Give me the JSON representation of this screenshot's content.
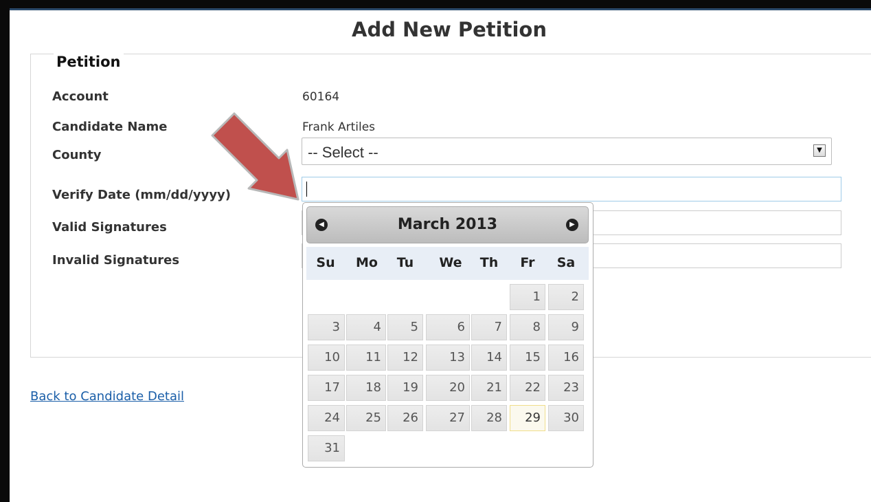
{
  "page": {
    "title": "Add New Petition",
    "section_legend": "Petition",
    "back_link": "Back to Candidate Detail"
  },
  "form": {
    "account": {
      "label": "Account",
      "value": "60164"
    },
    "candidate_name": {
      "label": "Candidate Name",
      "value": "Frank Artiles"
    },
    "county": {
      "label": "County",
      "selected": "-- Select --"
    },
    "verify_date": {
      "label": "Verify Date (mm/dd/yyyy)",
      "value": ""
    },
    "valid_signatures": {
      "label": "Valid Signatures",
      "value": ""
    },
    "invalid_signatures": {
      "label": "Invalid Signatures",
      "value": ""
    }
  },
  "datepicker": {
    "title": "March 2013",
    "prev_icon": "circle-triangle-w-icon",
    "next_icon": "circle-triangle-e-icon",
    "day_names": [
      "Su",
      "Mo",
      "Tu",
      "We",
      "Th",
      "Fr",
      "Sa"
    ],
    "first_weekday_index": 5,
    "days_in_month": 31,
    "highlighted_day": 29
  },
  "annotation": {
    "arrow_color": "#c0504d"
  }
}
